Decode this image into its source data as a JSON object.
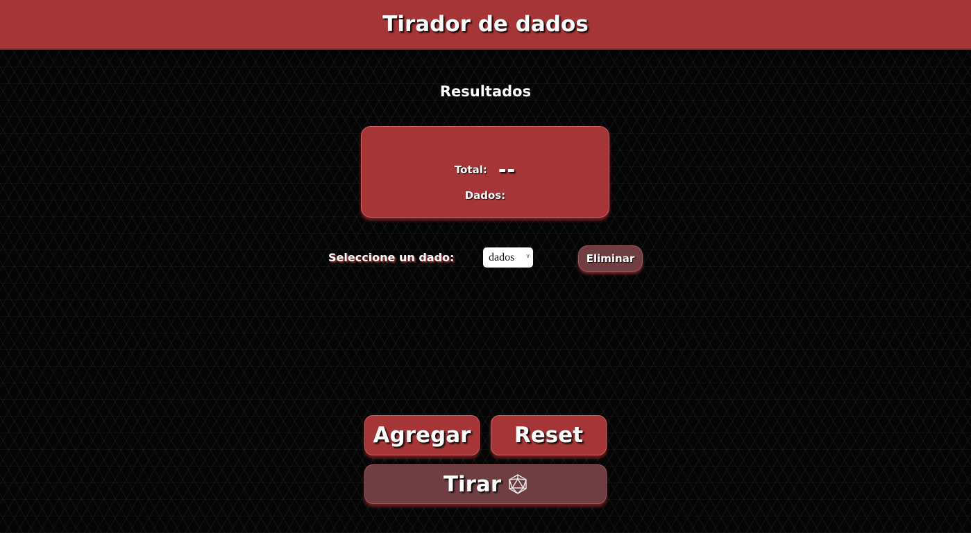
{
  "header": {
    "title": "Tirador de dados"
  },
  "results": {
    "heading": "Resultados",
    "total_label": "Total:",
    "total_value": "--",
    "dice_label": "Dados:"
  },
  "controls": {
    "select_label": "Seleccione un dado:",
    "select_value": "dados",
    "delete_label": "Eliminar",
    "add_label": "Agregar",
    "reset_label": "Reset",
    "roll_label": "Tirar",
    "roll_icon": "d20-icon"
  },
  "colors": {
    "primary": "#a53537",
    "muted": "#6f3e42",
    "background": "#050505"
  }
}
